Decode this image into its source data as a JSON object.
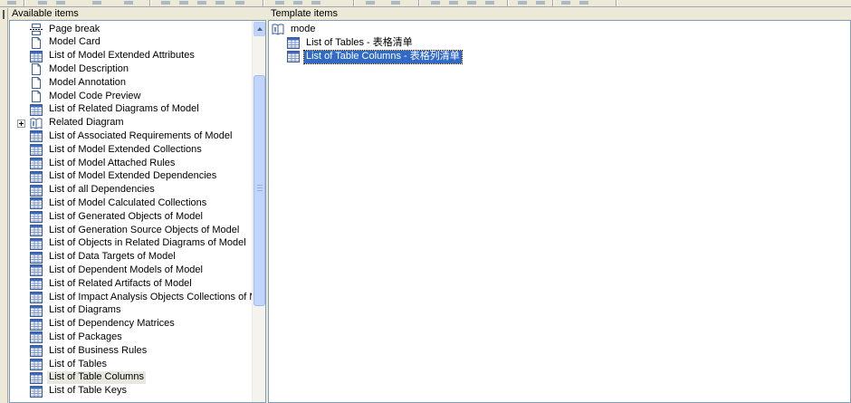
{
  "left_pane": {
    "header": "Available items",
    "items": [
      {
        "label": "Page break",
        "icon": "page-break-icon"
      },
      {
        "label": "Model Card",
        "icon": "card-icon"
      },
      {
        "label": "List of Model Extended Attributes",
        "icon": "list-table-icon"
      },
      {
        "label": "Model Description",
        "icon": "document-icon"
      },
      {
        "label": "Model Annotation",
        "icon": "document-icon"
      },
      {
        "label": "Model Code Preview",
        "icon": "document-icon"
      },
      {
        "label": "List of Related Diagrams of Model",
        "icon": "list-table-icon"
      },
      {
        "label": "Related Diagram",
        "icon": "book-icon",
        "expandable": true
      },
      {
        "label": "List of Associated Requirements of Model",
        "icon": "list-table-icon"
      },
      {
        "label": "List of Model Extended Collections",
        "icon": "list-table-icon"
      },
      {
        "label": "List of Model Attached Rules",
        "icon": "list-table-icon"
      },
      {
        "label": "List of Model Extended Dependencies",
        "icon": "list-table-icon"
      },
      {
        "label": "List of all Dependencies",
        "icon": "list-table-icon"
      },
      {
        "label": "List of Model Calculated Collections",
        "icon": "list-table-icon"
      },
      {
        "label": "List of Generated Objects of Model",
        "icon": "list-table-icon"
      },
      {
        "label": "List of Generation Source Objects of Model",
        "icon": "list-table-icon"
      },
      {
        "label": "List of Objects in Related Diagrams of Model",
        "icon": "list-table-icon"
      },
      {
        "label": "List of Data Targets of Model",
        "icon": "list-table-icon"
      },
      {
        "label": "List of Dependent Models of Model",
        "icon": "list-table-icon"
      },
      {
        "label": "List of Related Artifacts of Model",
        "icon": "list-table-icon"
      },
      {
        "label": "List of Impact Analysis Objects Collections of Mode",
        "icon": "list-table-icon"
      },
      {
        "label": "List of Diagrams",
        "icon": "list-table-icon"
      },
      {
        "label": "List of Dependency Matrices",
        "icon": "list-table-icon"
      },
      {
        "label": "List of Packages",
        "icon": "list-table-icon"
      },
      {
        "label": "List of Business Rules",
        "icon": "list-table-icon"
      },
      {
        "label": "List of Tables",
        "icon": "list-table-icon"
      },
      {
        "label": "List of Table Columns",
        "icon": "list-table-icon",
        "hover": true
      },
      {
        "label": "List of Table Keys",
        "icon": "list-table-icon"
      }
    ]
  },
  "right_pane": {
    "header": "Template items",
    "root": {
      "label": "mode",
      "icon": "book-icon"
    },
    "items": [
      {
        "label": "List of Tables - 表格清单",
        "icon": "list-table-icon"
      },
      {
        "label": "List of Table Columns - 表格列清单",
        "icon": "list-table-icon",
        "selected": true
      }
    ]
  },
  "colors": {
    "selection": "#316ac5",
    "pane_border": "#7f9db9",
    "window_bg": "#ece9d8"
  }
}
